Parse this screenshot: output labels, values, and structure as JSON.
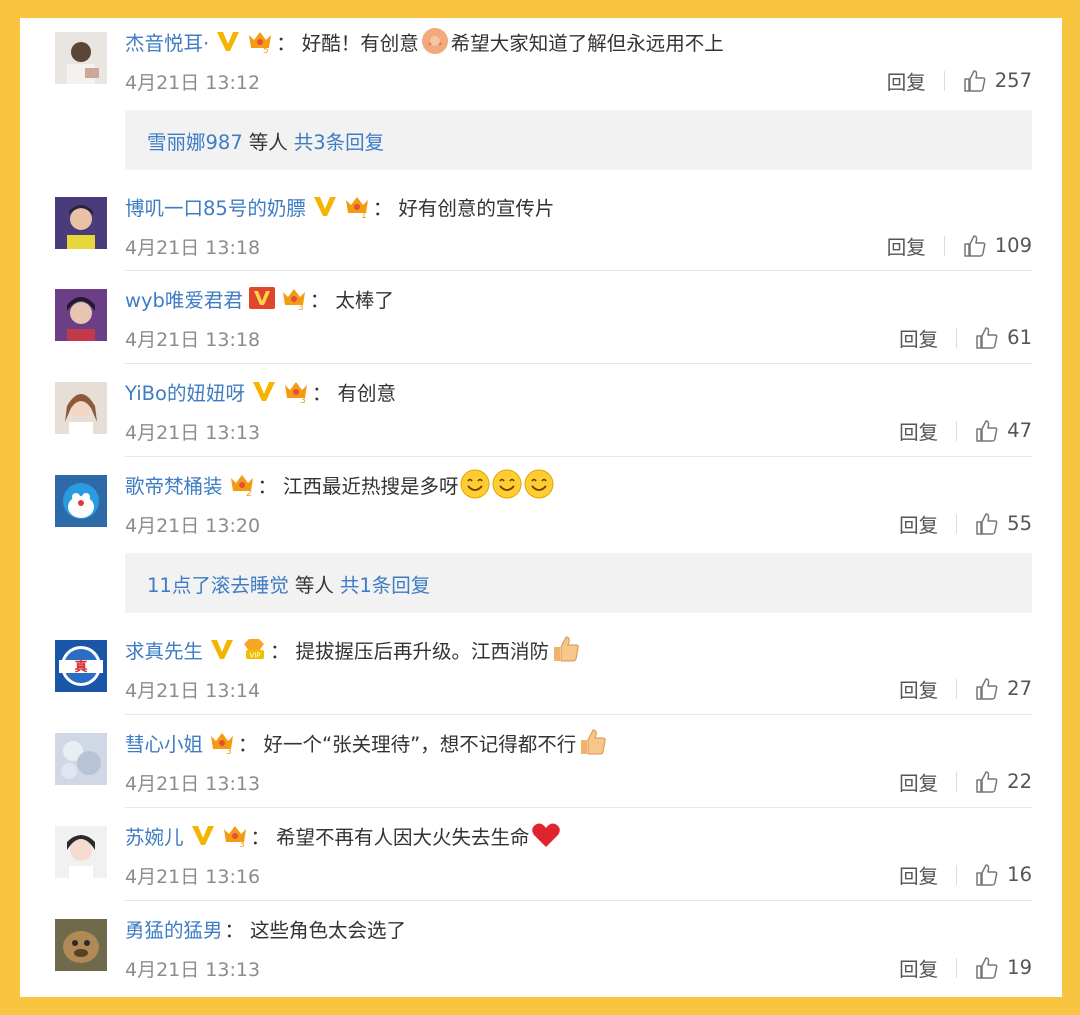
{
  "colors": {
    "frame": "#f9c440",
    "username": "#3e7cc4",
    "time": "#8c8c8c",
    "subreply_bg": "#f2f2f2"
  },
  "labels": {
    "reply": "回复",
    "colon": "："
  },
  "comments": [
    {
      "username": "杰音悦耳·",
      "badges": [
        "v-yellow-icon",
        "crown-level-5-icon"
      ],
      "text_parts": [
        "好酷！有创意",
        "{praying-hands-emoji}",
        "希望大家知道了解但永远用不上"
      ],
      "time": "4月21日 13:12",
      "likes": "257"
    },
    {
      "username": "博叽一口85号的奶膘",
      "badges": [
        "v-yellow-icon",
        "crown-level-1-icon"
      ],
      "text": "好有创意的宣传片",
      "time": "4月21日 13:18",
      "likes": "109"
    },
    {
      "username": "wyb唯爱君君",
      "badges": [
        "v-red-icon",
        "crown-level-3-icon"
      ],
      "text": "太棒了",
      "time": "4月21日 13:18",
      "likes": "61"
    },
    {
      "username": "YiBo的妞妞呀",
      "badges": [
        "v-yellow-icon",
        "crown-level-3-icon"
      ],
      "text": "有创意",
      "time": "4月21日 13:13",
      "likes": "47"
    },
    {
      "username": "歌帝梵桶装",
      "badges": [
        "crown-level-2-icon"
      ],
      "text": "江西最近热搜是多呀",
      "emojis": [
        "smile-emoji",
        "smile-emoji",
        "smile-emoji"
      ],
      "time": "4月21日 13:20",
      "likes": "55"
    },
    {
      "username": "求真先生",
      "badges": [
        "v-yellow-icon",
        "vip-diamond-icon"
      ],
      "text": "提拔握压后再升级。江西消防",
      "emojis": [
        "thumbs-up-emoji"
      ],
      "time": "4月21日 13:14",
      "likes": "27"
    },
    {
      "username": "彗心小姐",
      "badges": [
        "crown-level-3-icon"
      ],
      "text": "好一个“张关理待”，想不记得都不行",
      "emojis": [
        "thumbs-up-emoji"
      ],
      "time": "4月21日 13:13",
      "likes": "22"
    },
    {
      "username": "苏婉儿",
      "badges": [
        "v-yellow-icon",
        "crown-level-3-icon"
      ],
      "text": "希望不再有人因大火失去生命",
      "emojis": [
        "red-heart-emoji"
      ],
      "time": "4月21日 13:16",
      "likes": "16"
    },
    {
      "username": "勇猛的猛男",
      "badges": [],
      "text": "这些角色太会选了",
      "time": "4月21日 13:13",
      "likes": "19"
    }
  ],
  "subreplies": [
    {
      "user": "雪丽娜987",
      "mid": "等人",
      "count": "共3条回复"
    },
    {
      "user": "11点了滚去睡觉",
      "mid": "等人",
      "count": "共1条回复"
    }
  ]
}
